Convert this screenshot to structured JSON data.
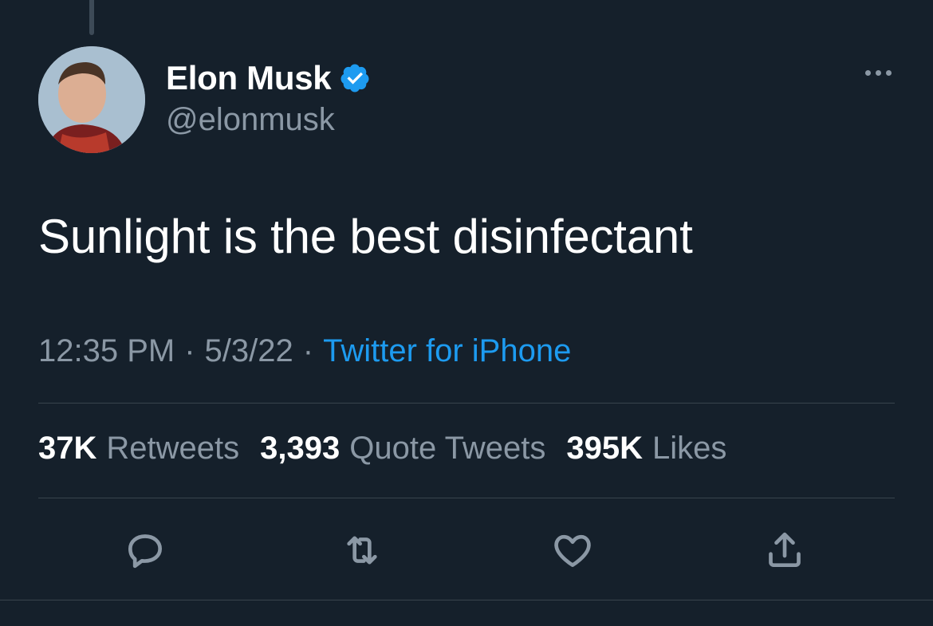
{
  "author": {
    "name": "Elon Musk",
    "handle": "@elonmusk",
    "verified": true,
    "verified_color": "#1d9bf0"
  },
  "tweet": {
    "text": "Sunlight is the best disinfectant",
    "time": "12:35 PM",
    "date": "5/3/22",
    "separator": "·",
    "source": "Twitter for iPhone"
  },
  "stats": {
    "retweets": {
      "count": "37K",
      "label": "Retweets"
    },
    "quotes": {
      "count": "3,393",
      "label": "Quote Tweets"
    },
    "likes": {
      "count": "395K",
      "label": "Likes"
    }
  },
  "icons": {
    "reply": "reply-icon",
    "retweet": "retweet-icon",
    "like": "heart-icon",
    "share": "share-icon",
    "more": "more-icon"
  },
  "colors": {
    "background": "#15202b",
    "primary_text": "#ffffff",
    "secondary_text": "#8b98a5",
    "accent": "#1d9bf0",
    "divider": "#38444d"
  }
}
